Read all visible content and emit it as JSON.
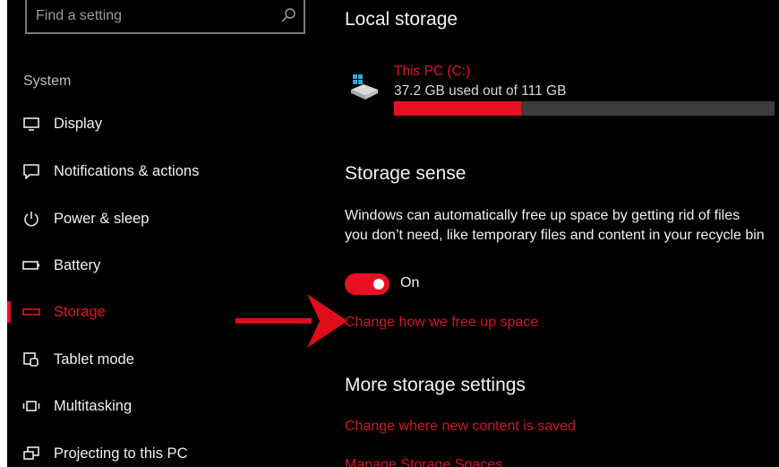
{
  "search": {
    "placeholder": "Find a setting",
    "icon": "search-icon"
  },
  "sidebar": {
    "section_label": "System",
    "items": [
      {
        "label": "Display",
        "icon": "display-icon",
        "active": false
      },
      {
        "label": "Notifications & actions",
        "icon": "notifications-icon",
        "active": false
      },
      {
        "label": "Power & sleep",
        "icon": "power-icon",
        "active": false
      },
      {
        "label": "Battery",
        "icon": "battery-icon",
        "active": false
      },
      {
        "label": "Storage",
        "icon": "storage-icon",
        "active": true
      },
      {
        "label": "Tablet mode",
        "icon": "tablet-mode-icon",
        "active": false
      },
      {
        "label": "Multitasking",
        "icon": "multitasking-icon",
        "active": false
      },
      {
        "label": "Projecting to this PC",
        "icon": "projecting-icon",
        "active": false
      }
    ]
  },
  "main": {
    "local_storage": {
      "title": "Local storage",
      "drive_name": "This PC (C:)",
      "usage_text": "37.2 GB used out of 111 GB",
      "used_fraction": 0.335
    },
    "storage_sense": {
      "title": "Storage sense",
      "description": "Windows can automatically free up space by getting rid of files you don’t need, like temporary files and content in your recycle bin",
      "toggle_state": "On",
      "link": "Change how we free up space"
    },
    "more_settings": {
      "title": "More storage settings",
      "link_new_content": "Change where new content is saved",
      "link_spaces": "Manage Storage Spaces"
    }
  },
  "colors": {
    "accent": "#e81123",
    "background": "#000000",
    "annotation_arrow": "#e00c1a"
  }
}
